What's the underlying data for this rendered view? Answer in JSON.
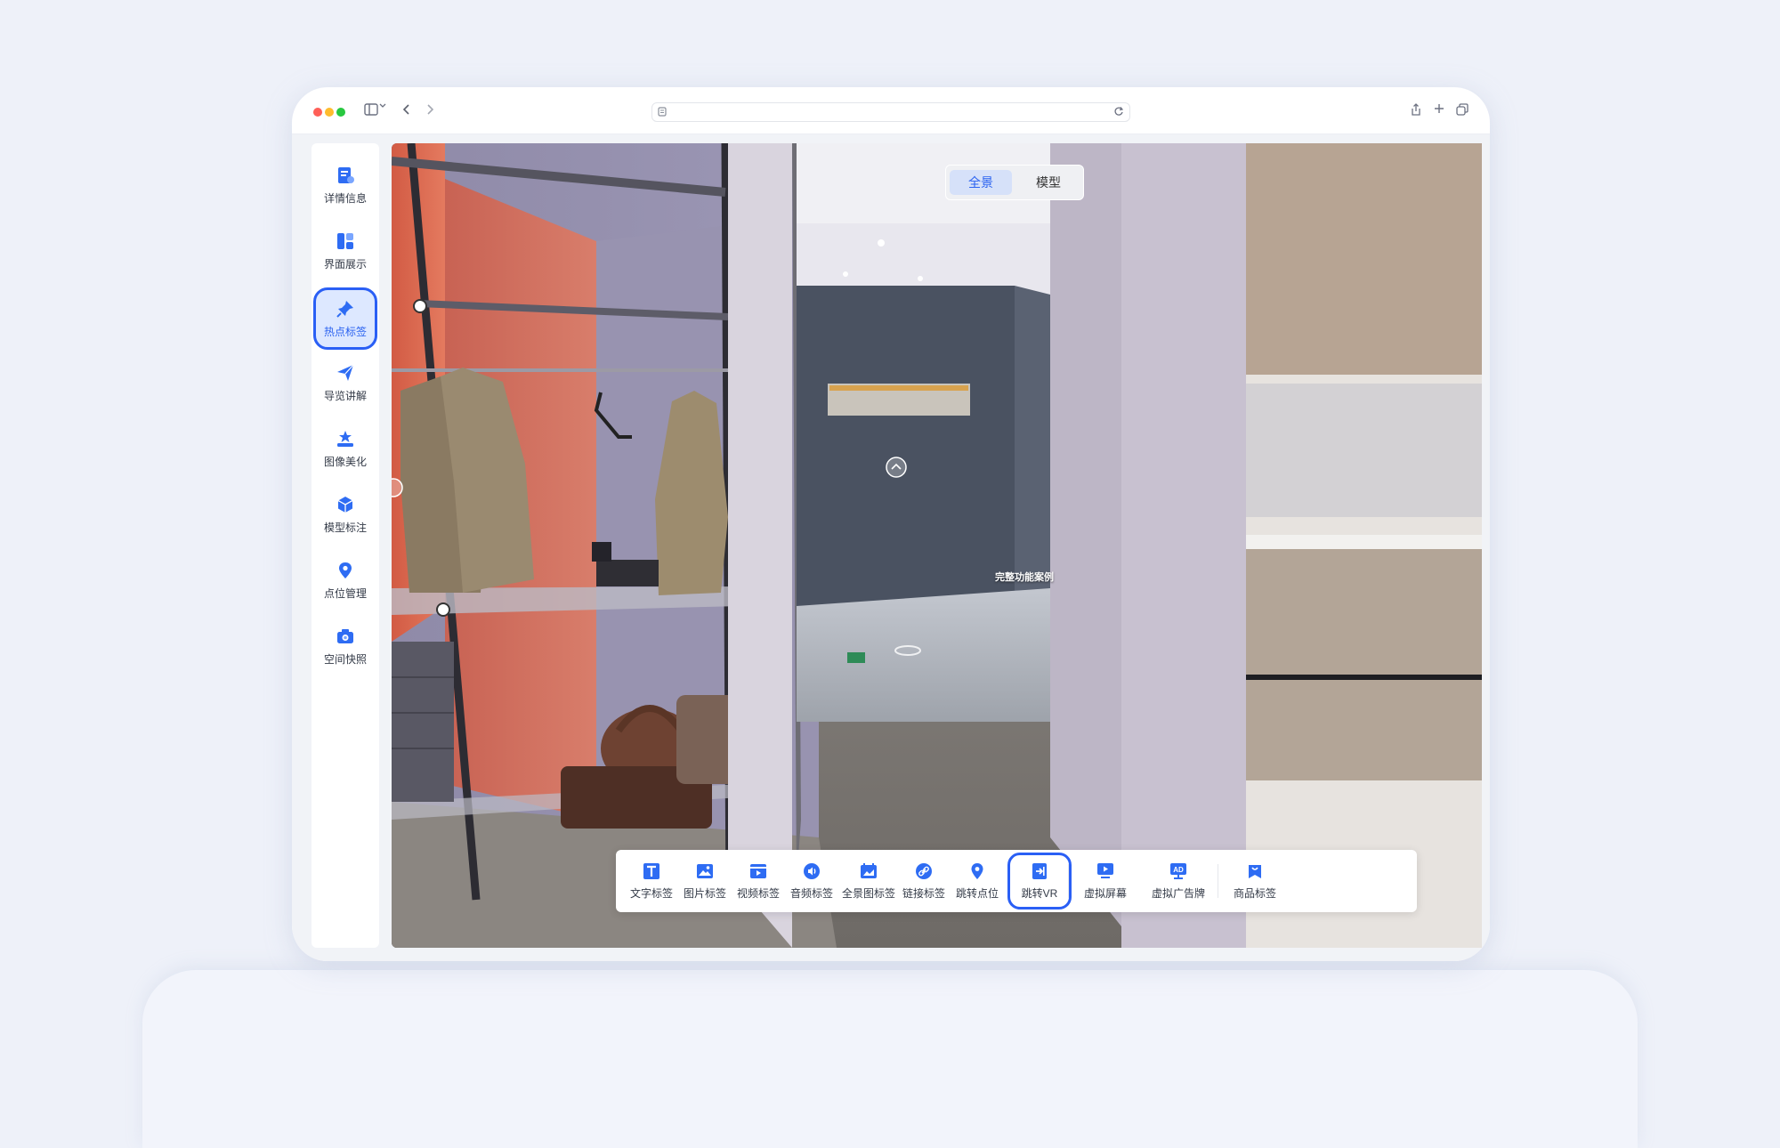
{
  "sidebar": {
    "items": [
      {
        "label": "详情信息",
        "icon": "document-icon",
        "active": false
      },
      {
        "label": "界面展示",
        "icon": "layout-icon",
        "active": false
      },
      {
        "label": "热点标签",
        "icon": "pin-icon",
        "active": true
      },
      {
        "label": "导览讲解",
        "icon": "paper-plane-icon",
        "active": false
      },
      {
        "label": "图像美化",
        "icon": "image-enhance-icon",
        "active": false
      },
      {
        "label": "模型标注",
        "icon": "cube-icon",
        "active": false
      },
      {
        "label": "点位管理",
        "icon": "location-icon",
        "active": false
      },
      {
        "label": "空间快照",
        "icon": "camera-icon",
        "active": false
      }
    ]
  },
  "view_toggle": {
    "panorama_label": "全景",
    "model_label": "模型",
    "selected": "全景"
  },
  "hotspot": {
    "label": "完整功能案例"
  },
  "dock": {
    "items": [
      {
        "label": "文字标签",
        "icon": "text-icon"
      },
      {
        "label": "图片标签",
        "icon": "image-icon"
      },
      {
        "label": "视频标签",
        "icon": "video-icon"
      },
      {
        "label": "音频标签",
        "icon": "audio-icon"
      },
      {
        "label": "全景图标签",
        "icon": "panorama-icon"
      },
      {
        "label": "链接标签",
        "icon": "link-icon"
      },
      {
        "label": "跳转点位",
        "icon": "location-icon"
      },
      {
        "label": "跳转VR",
        "icon": "vr-jump-icon",
        "active": true
      },
      {
        "label": "虚拟屏幕",
        "icon": "screen-icon"
      },
      {
        "label": "虚拟广告牌",
        "icon": "ad-billboard-icon"
      },
      {
        "label": "商品标签",
        "icon": "product-tag-icon"
      }
    ]
  },
  "colors": {
    "accent": "#2a5ff5",
    "icon_blue": "#2e6cf3",
    "background": "#eef1f9"
  }
}
